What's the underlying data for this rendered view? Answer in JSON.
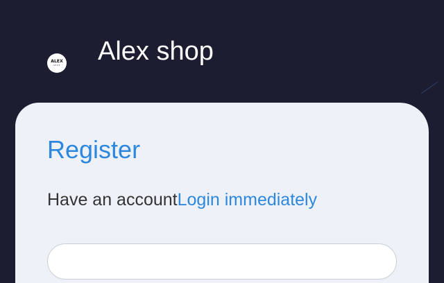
{
  "header": {
    "logo": {
      "text": "ALEX",
      "subtext": "SHOP"
    },
    "title": "Alex shop"
  },
  "register": {
    "title": "Register",
    "prompt": "Have an account",
    "login_link": "Login immediately"
  },
  "colors": {
    "background": "#1c1d30",
    "card": "#eef2f8",
    "accent": "#2d87dc"
  }
}
